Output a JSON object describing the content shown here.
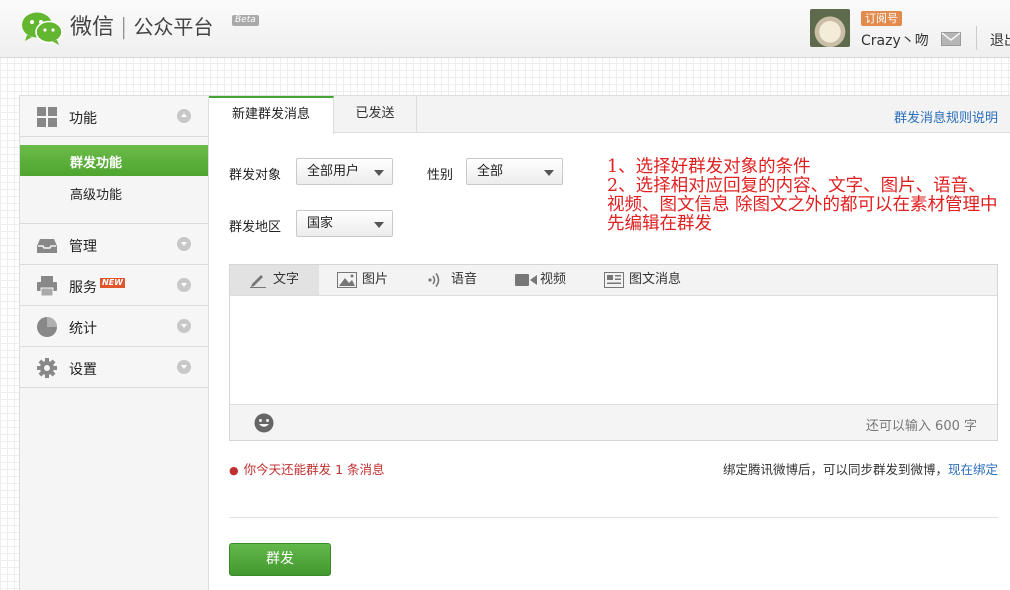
{
  "header": {
    "brand_name": "微信",
    "brand_separator": "|",
    "brand_sub": "公众平台",
    "beta": "Beta",
    "account_badge": "订阅号",
    "username": "Crazy丶吻",
    "logout": "退出"
  },
  "sidebar": {
    "groups": [
      {
        "label": "功能",
        "icon": "grid-icon",
        "expanded": true
      },
      {
        "label": "管理",
        "icon": "inbox-icon"
      },
      {
        "label": "服务",
        "icon": "printer-icon",
        "badge": "NEW"
      },
      {
        "label": "统计",
        "icon": "pie-chart-icon"
      },
      {
        "label": "设置",
        "icon": "gear-icon"
      }
    ],
    "sub_items": [
      "群发功能",
      "高级功能"
    ]
  },
  "tabs": [
    "新建群发消息",
    "已发送"
  ],
  "rules_link": "群发消息规则说明",
  "form": {
    "target_label": "群发对象",
    "target_value": "全部用户",
    "gender_label": "性别",
    "gender_value": "全部",
    "region_label": "群发地区",
    "region_value": "国家"
  },
  "annotation": "1、选择好群发对象的条件\n2、选择相对应回复的内容、文字、图片、语音、视频、图文信息 除图文之外的都可以在素材管理中先编辑在群发",
  "editor": {
    "tabs": [
      "文字",
      "图片",
      "语音",
      "视频",
      "图文消息"
    ],
    "counter": "还可以输入 600 字"
  },
  "quota_text": "你今天还能群发 1 条消息",
  "bind_text": "绑定腾讯微博后，可以同步群发到微博，",
  "bind_link": "现在绑定",
  "send_button": "群发",
  "colors": {
    "accent_green": "#4fa52f",
    "link_blue": "#2a6ebb",
    "annotation_red": "#e02020"
  }
}
